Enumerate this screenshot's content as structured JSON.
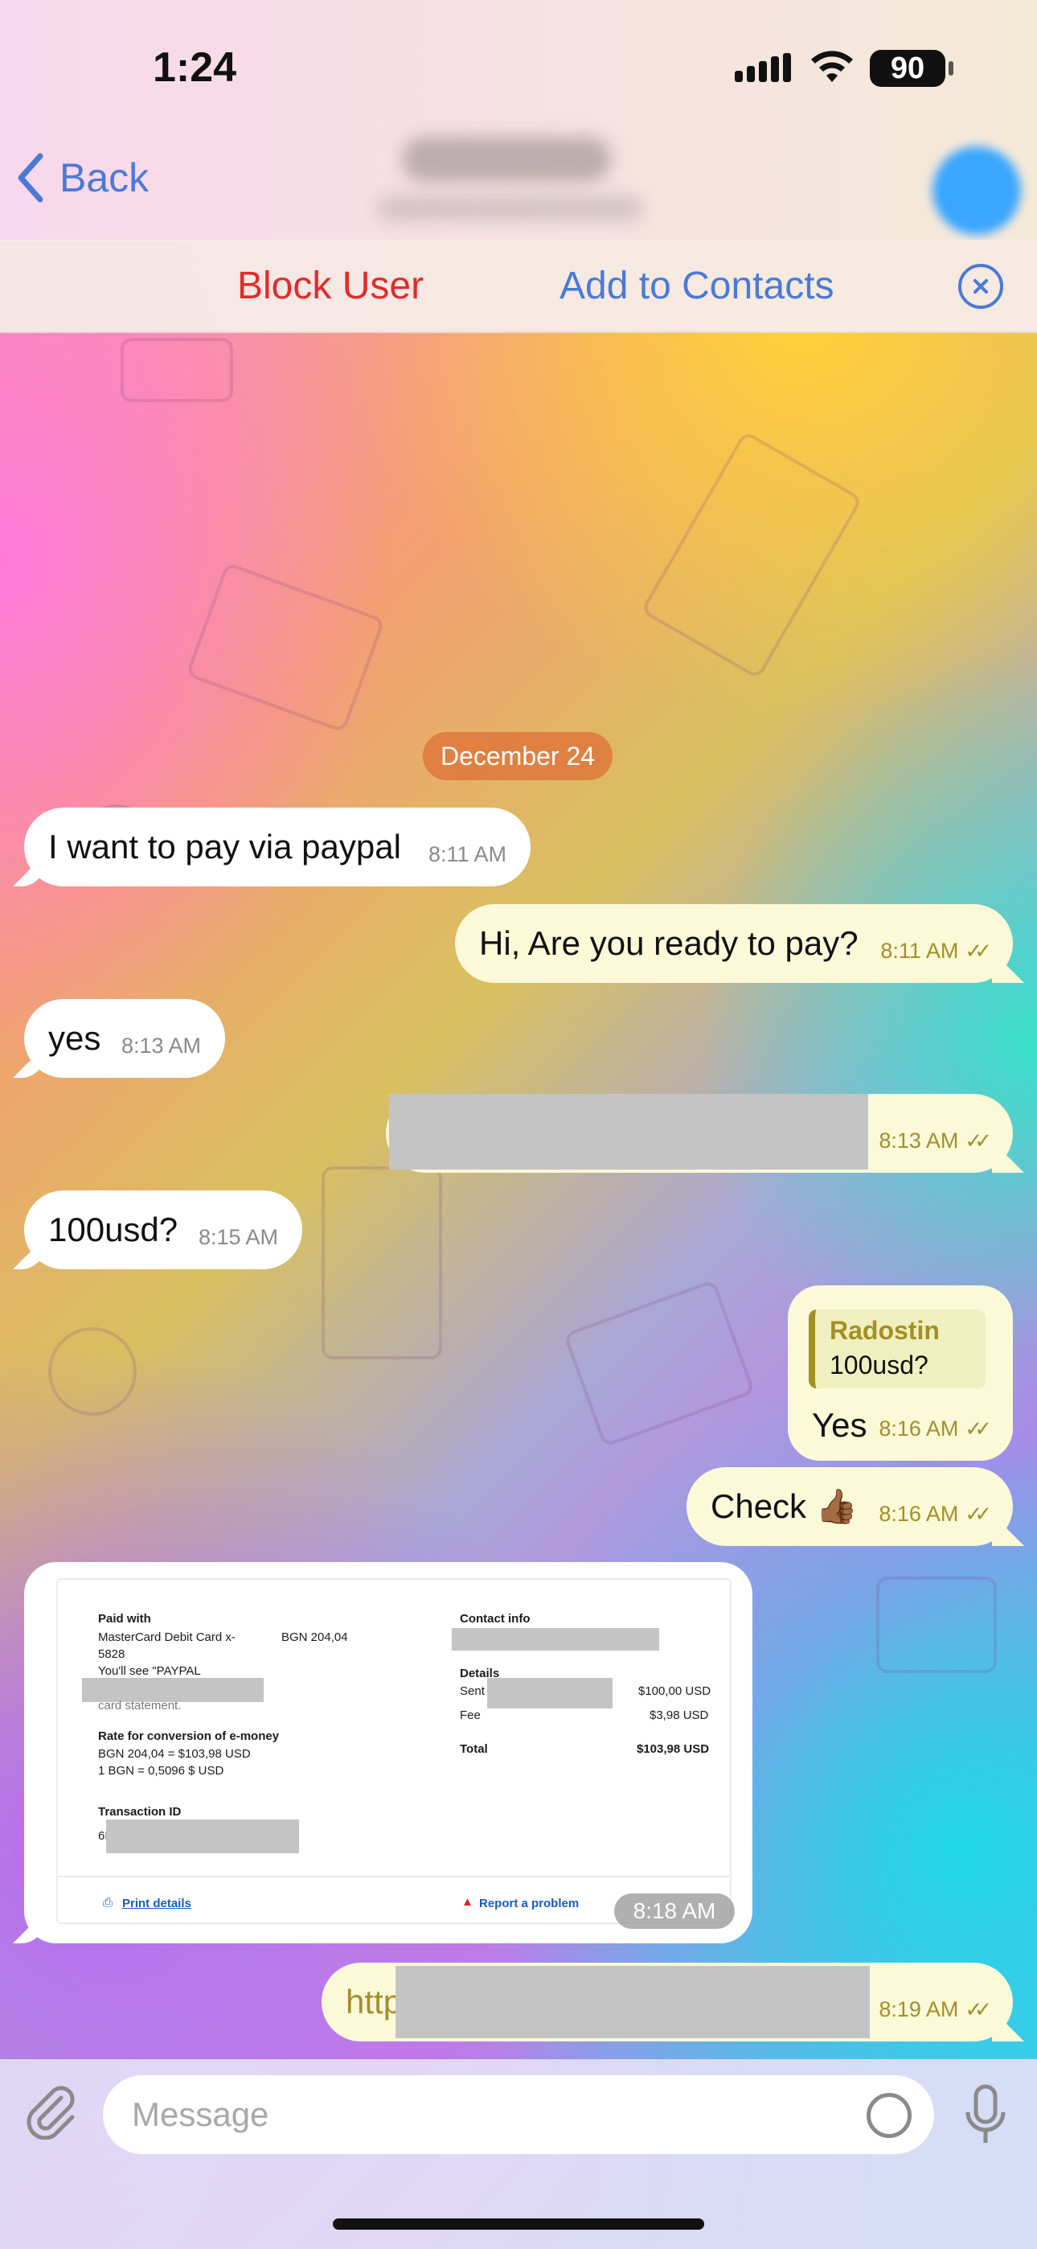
{
  "status_bar": {
    "time": "1:24",
    "battery": "90"
  },
  "header": {
    "back_label": "Back"
  },
  "action_bar": {
    "block_label": "Block User",
    "add_contacts_label": "Add to Contacts"
  },
  "chat": {
    "date": "December 24",
    "messages": [
      {
        "text": "I want to pay via paypal",
        "time": "8:11 AM"
      },
      {
        "text": "Hi, Are you ready to pay?",
        "time": "8:11 AM"
      },
      {
        "text": "yes",
        "time": "8:13 AM"
      },
      {
        "time": "8:13 AM"
      },
      {
        "text": "100usd?",
        "time": "8:15 AM"
      },
      {
        "reply_name": "Radostin",
        "reply_text": "100usd?",
        "text": "Yes",
        "time": "8:16 AM"
      },
      {
        "text": "Check 👍🏾",
        "time": "8:16 AM"
      },
      {
        "time": "8:18 AM"
      },
      {
        "text": "http",
        "time": "8:19 AM"
      }
    ]
  },
  "receipt": {
    "paid_with_label": "Paid with",
    "card_line1": "MasterCard Debit Card x-",
    "card_line2": "5828",
    "amount_bgn": "BGN 204,04",
    "youll_see": "You'll see \"PAYPAL",
    "card_statement": "card statement.",
    "rate_label": "Rate for conversion of e-money",
    "rate_line1": "BGN 204,04 = $103,98 USD",
    "rate_line2": "1 BGN = 0,5096 $ USD",
    "txn_label": "Transaction ID",
    "txn_prefix": "6F",
    "contact_label": "Contact info",
    "details_label": "Details",
    "sent_label": "Sent t",
    "sent_amount": "$100,00 USD",
    "fee_label": "Fee",
    "fee_amount": "$3,98 USD",
    "total_label": "Total",
    "total_amount": "$103,98 USD",
    "print_label": "Print details",
    "report_label": "Report a problem"
  },
  "input": {
    "placeholder": "Message"
  }
}
